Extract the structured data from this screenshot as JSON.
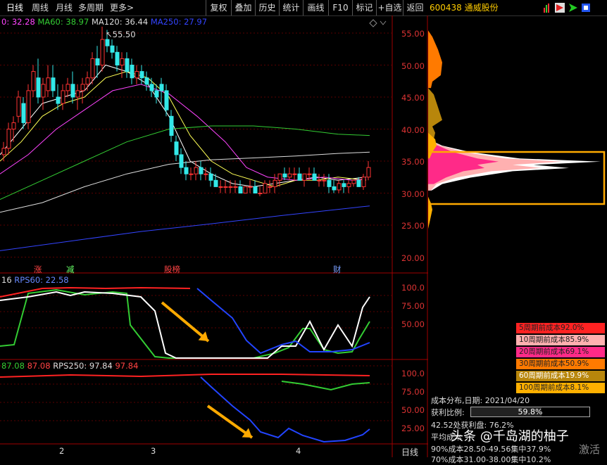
{
  "toolbar": {
    "left": [
      "日线",
      "周线",
      "月线",
      "多周期",
      "更多>"
    ],
    "right": [
      "复权",
      "叠加",
      "历史",
      "统计",
      "画线",
      "F10",
      "标记",
      "+自选",
      "返回"
    ]
  },
  "stock": {
    "code": "600438",
    "name": "通威股份"
  },
  "main_legend": {
    "ma30": "0: 32.28",
    "ma60": "MA60: 38.97",
    "ma120": "MA120: 36.44",
    "ma250": "MA250: 27.97"
  },
  "max_label": "55.50",
  "price_axis": [
    "55.00",
    "50.00",
    "45.00",
    "40.00",
    "35.00",
    "30.00",
    "25.00",
    "20.00"
  ],
  "markers": [
    {
      "text": "涨",
      "color": "#ff4444"
    },
    {
      "text": "减",
      "color": "#66ff66"
    },
    {
      "text": "股榜",
      "color": "#ff4444"
    },
    {
      "text": "财",
      "color": "#7aa0ff"
    }
  ],
  "rps_legend": {
    "a": "16",
    "b": "RPS60: 22.58"
  },
  "rps_axis": [
    "100.0",
    "75.00",
    "50.00"
  ],
  "rps2_legend": {
    "a": "87.08",
    "b": "87.08",
    "c": "RPS250: 97.84",
    "d": "97.84"
  },
  "rps2_axis": [
    "100.0",
    "75.00",
    "50.00",
    "25.00"
  ],
  "date_axis": [
    "2",
    "3",
    "4"
  ],
  "period_tag": "日线",
  "cost_rows": [
    {
      "label": "5周期前成本92.0%",
      "bg": "#ff2222",
      "fg": "#222"
    },
    {
      "label": "10周期前成本85.9%",
      "bg": "#ffb0b0",
      "fg": "#222"
    },
    {
      "label": "20周期前成本69.1%",
      "bg": "#ff2a88",
      "fg": "#222"
    },
    {
      "label": "30周期前成本50.9%",
      "bg": "#ff7a00",
      "fg": "#222"
    },
    {
      "label": "60周期前成本19.9%",
      "bg": "#b8860b",
      "fg": "#fff"
    },
    {
      "label": "100周期前成本8.1%",
      "bg": "#ffb000",
      "fg": "#222"
    }
  ],
  "dist_info": {
    "date_line": "成本分布,日期: 2021/04/20",
    "profit_label": "获利比例:",
    "profit_value": "59.8%",
    "profit_ratio": 0.598,
    "line3": "42.52处获利盘: 76.2%",
    "line4": "平均成本",
    "line5": "90%成本28.50-49.56集中37.9%",
    "line6": "70%成本31.00-38.00集中10.2%"
  },
  "watermark": "头条 @千岛湖的柚子",
  "watermark2": "激活",
  "colors": {
    "up": "#ff3333",
    "down": "#33e8e8",
    "ma5": "#ffffff",
    "ma10": "#ffff55",
    "ma20": "#ff44ff",
    "ma60": "#33cc33",
    "ma120": "#dddddd",
    "ma250": "#3344ff",
    "accent": "#ffaa00"
  }
}
